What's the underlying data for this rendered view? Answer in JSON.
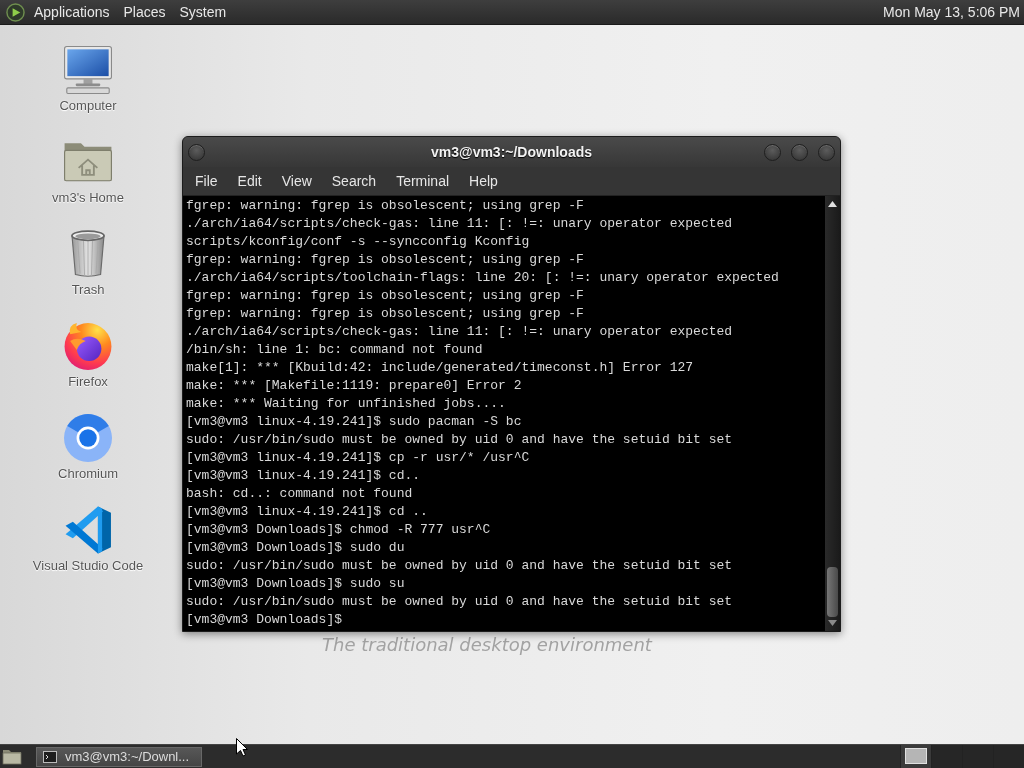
{
  "top_panel": {
    "menus": [
      "Applications",
      "Places",
      "System"
    ],
    "clock": "Mon May 13, 5:06 PM"
  },
  "desktop": {
    "icons": [
      {
        "label": "Computer",
        "kind": "computer"
      },
      {
        "label": "vm3's Home",
        "kind": "home"
      },
      {
        "label": "Trash",
        "kind": "trash"
      },
      {
        "label": "Firefox",
        "kind": "firefox"
      },
      {
        "label": "Chromium",
        "kind": "chromium"
      },
      {
        "label": "Visual Studio Code",
        "kind": "vscode"
      }
    ],
    "wallpaper_text": "The traditional desktop environment"
  },
  "terminal_window": {
    "title": "vm3@vm3:~/Downloads",
    "menu": [
      "File",
      "Edit",
      "View",
      "Search",
      "Terminal",
      "Help"
    ],
    "lines": [
      "fgrep: warning: fgrep is obsolescent; using grep -F",
      "./arch/ia64/scripts/check-gas: line 11: [: !=: unary operator expected",
      "scripts/kconfig/conf -s --syncconfig Kconfig",
      "fgrep: warning: fgrep is obsolescent; using grep -F",
      "./arch/ia64/scripts/toolchain-flags: line 20: [: !=: unary operator expected",
      "fgrep: warning: fgrep is obsolescent; using grep -F",
      "fgrep: warning: fgrep is obsolescent; using grep -F",
      "./arch/ia64/scripts/check-gas: line 11: [: !=: unary operator expected",
      "/bin/sh: line 1: bc: command not found",
      "make[1]: *** [Kbuild:42: include/generated/timeconst.h] Error 127",
      "make: *** [Makefile:1119: prepare0] Error 2",
      "make: *** Waiting for unfinished jobs....",
      "[vm3@vm3 linux-4.19.241]$ sudo pacman -S bc",
      "sudo: /usr/bin/sudo must be owned by uid 0 and have the setuid bit set",
      "[vm3@vm3 linux-4.19.241]$ cp -r usr/* /usr^C",
      "[vm3@vm3 linux-4.19.241]$ cd..",
      "bash: cd..: command not found",
      "[vm3@vm3 linux-4.19.241]$ cd ..",
      "[vm3@vm3 Downloads]$ chmod -R 777 usr^C",
      "[vm3@vm3 Downloads]$ sudo du",
      "sudo: /usr/bin/sudo must be owned by uid 0 and have the setuid bit set",
      "[vm3@vm3 Downloads]$ sudo su",
      "sudo: /usr/bin/sudo must be owned by uid 0 and have the setuid bit set",
      "[vm3@vm3 Downloads]$"
    ]
  },
  "taskbar": {
    "tasks": [
      {
        "label": "vm3@vm3:~/Downl...",
        "selected": true
      }
    ],
    "workspaces": [
      {
        "selected": true
      },
      {
        "selected": false
      },
      {
        "selected": false
      },
      {
        "selected": false
      }
    ]
  }
}
